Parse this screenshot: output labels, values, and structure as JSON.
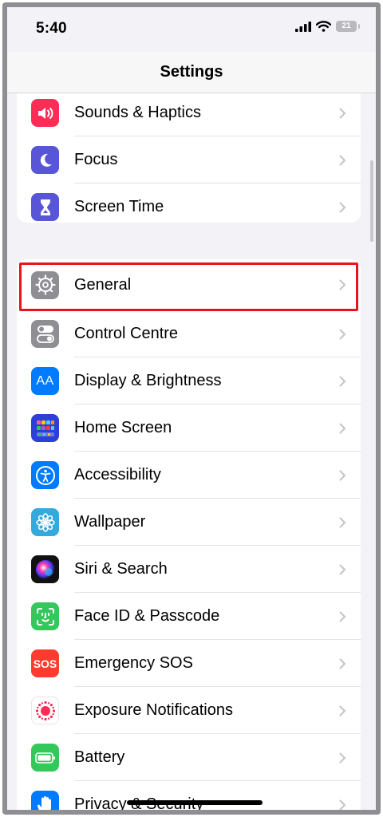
{
  "status": {
    "time": "5:40",
    "battery": "21"
  },
  "nav": {
    "title": "Settings"
  },
  "colors": {
    "highlight": "#e6141e",
    "background": "#f2f2f7"
  },
  "group1": [
    {
      "label": "Sounds & Haptics",
      "icon": "speaker-icon",
      "color": "#ff2d55"
    },
    {
      "label": "Focus",
      "icon": "moon-icon",
      "color": "#5856d6"
    },
    {
      "label": "Screen Time",
      "icon": "hourglass-icon",
      "color": "#5856d6"
    }
  ],
  "group2": [
    {
      "label": "General",
      "icon": "gear-icon",
      "color": "#8e8e93"
    },
    {
      "label": "Control Centre",
      "icon": "toggles-icon",
      "color": "#8e8e93"
    },
    {
      "label": "Display & Brightness",
      "icon": "display-icon",
      "glyph": "AA",
      "color": "#007aff"
    },
    {
      "label": "Home Screen",
      "icon": "home-grid-icon",
      "color": "#2c3fd6"
    },
    {
      "label": "Accessibility",
      "icon": "accessibility-icon",
      "color": "#007aff"
    },
    {
      "label": "Wallpaper",
      "icon": "flower-icon",
      "color": "#34aadc"
    },
    {
      "label": "Siri & Search",
      "icon": "siri-icon",
      "color": "#111111"
    },
    {
      "label": "Face ID & Passcode",
      "icon": "face-id-icon",
      "color": "#34c759"
    },
    {
      "label": "Emergency SOS",
      "icon": "sos-icon",
      "glyph": "SOS",
      "color": "#ff3b30"
    },
    {
      "label": "Exposure Notifications",
      "icon": "exposure-icon",
      "color": "#ffffff"
    },
    {
      "label": "Battery",
      "icon": "battery-icon",
      "color": "#34c759"
    },
    {
      "label": "Privacy & Security",
      "icon": "hand-icon",
      "color": "#007aff"
    }
  ]
}
